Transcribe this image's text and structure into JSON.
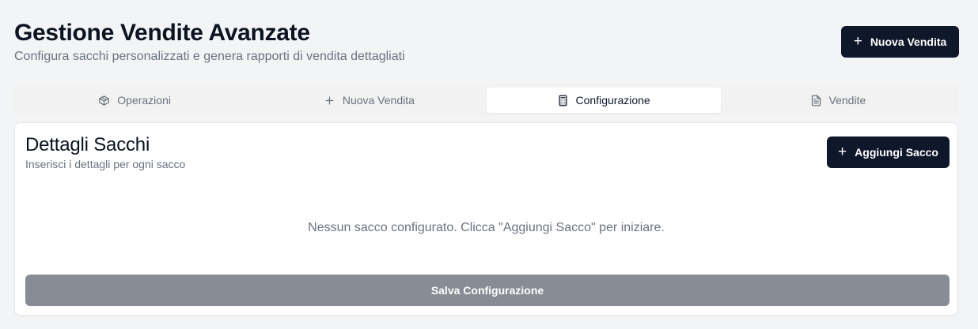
{
  "header": {
    "title": "Gestione Vendite Avanzate",
    "subtitle": "Configura sacchi personalizzati e genera rapporti di vendita dettagliati",
    "new_sale_button": {
      "icon": "plus-icon",
      "label": "Nuova Vendita"
    }
  },
  "tabs": [
    {
      "icon": "box-icon",
      "label": "Operazioni",
      "active": false
    },
    {
      "icon": "plus-icon",
      "label": "Nuova Vendita",
      "active": false
    },
    {
      "icon": "calculator-icon",
      "label": "Configurazione",
      "active": true
    },
    {
      "icon": "file-text-icon",
      "label": "Vendite",
      "active": false
    }
  ],
  "card": {
    "title": "Dettagli Sacchi",
    "description": "Inserisci i dettagli per ogni sacco",
    "add_button": {
      "icon": "plus-icon",
      "label": "Aggiungi Sacco"
    },
    "empty_message": "Nessun sacco configurato. Clicca \"Aggiungi Sacco\" per iniziare.",
    "save_button": {
      "label": "Salva Configurazione",
      "disabled": true
    }
  },
  "colors": {
    "primary": "#0f172a",
    "background": "#f3f4f6",
    "muted_text": "#6b7280",
    "disabled_button": "#888c94"
  }
}
